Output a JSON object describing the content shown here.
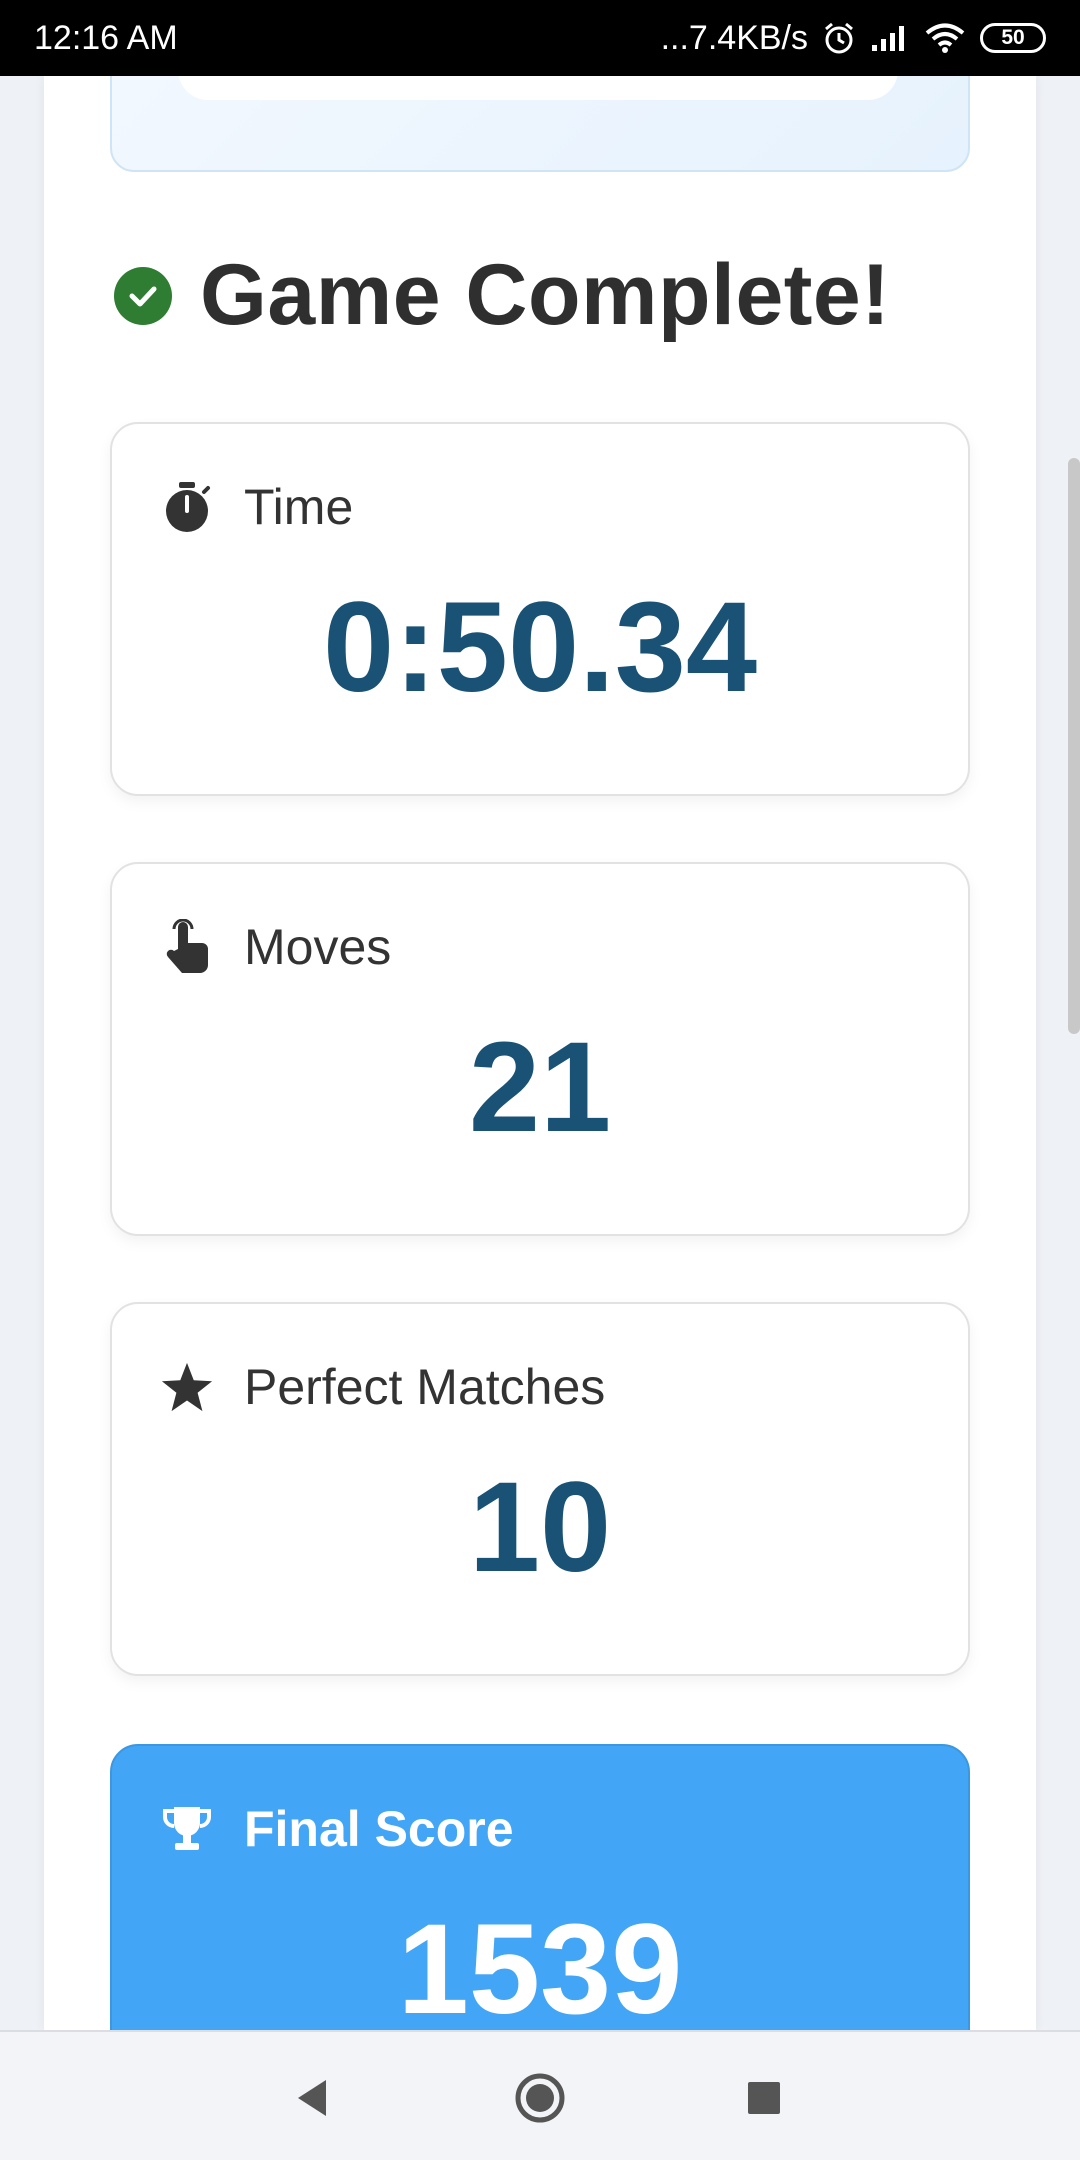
{
  "status_bar": {
    "time": "12:16 AM",
    "network_speed": "...7.4KB/s",
    "battery": "50"
  },
  "heading": {
    "title": "Game Complete!",
    "icon": "check-circle-icon",
    "icon_color": "#2e7d32"
  },
  "stats": {
    "time": {
      "label": "Time",
      "value": "0:50.34",
      "icon": "stopwatch-icon"
    },
    "moves": {
      "label": "Moves",
      "value": "21",
      "icon": "pointer-hand-icon"
    },
    "perfect_matches": {
      "label": "Perfect Matches",
      "value": "10",
      "icon": "star-icon"
    },
    "final_score": {
      "label": "Final Score",
      "value": "1539",
      "icon": "trophy-icon"
    }
  },
  "colors": {
    "value_text": "#1a5276",
    "score_card_bg": "#42a5f5"
  },
  "nav_bar": {
    "buttons": [
      "back",
      "home",
      "recents"
    ]
  }
}
